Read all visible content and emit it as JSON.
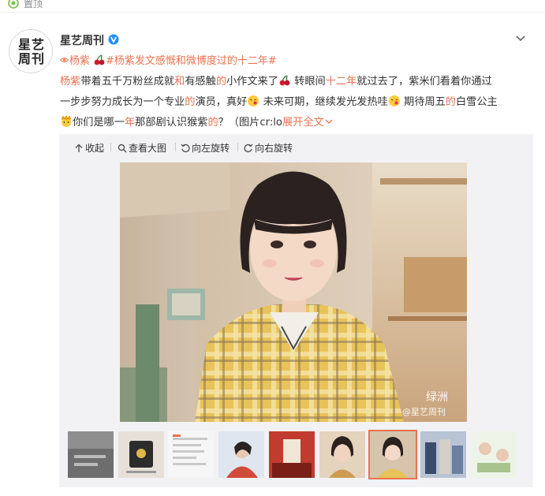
{
  "topbar": {
    "label": "置顶"
  },
  "post": {
    "avatar_line1": "星艺",
    "avatar_line2": "周刊",
    "author": "星艺周刊",
    "topics": [
      "杨紫",
      "#杨紫发文感慨和微博度过的十二年#"
    ],
    "text": {
      "l1a": "杨紫",
      "l1b": "带着五千万粉丝成就",
      "l1c": "和",
      "l1d": "有感触",
      "l1e": "的",
      "l1f": "小作文来了",
      "l1g": " 转眼间",
      "l1h": "十二年",
      "l1i": "就过去了，紫米们看着你通过",
      "l2a": "一步步努力成长为一个专业",
      "l2b": "的",
      "l2c": "演员，真好",
      "l2d": " 未来可期，继续发光发热哇",
      "l2e": " 期待周五",
      "l2f": "的",
      "l2g": "白雪公主",
      "l3a": "你们是哪一",
      "l3b": "年",
      "l3c": "那部剧认识猴紫",
      "l3d": "的",
      "l3e": "？（图片cr:lo",
      "expand": "展开全文"
    }
  },
  "media": {
    "toolbar": {
      "collapse": "收起",
      "view_large": "查看大图",
      "rotate_left": "向左旋转",
      "rotate_right": "向右旋转"
    },
    "watermark_artist": "绿洲",
    "watermark_weibo": "@星艺周刊",
    "thumbnail_count": 9,
    "selected_thumbnail": 7
  },
  "colors": {
    "accent": "#eb7350",
    "toolbar_bg": "#f2f2f5",
    "verified": "#1e90ff"
  }
}
